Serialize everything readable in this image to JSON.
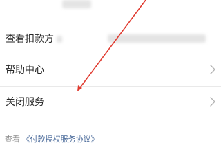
{
  "settings_list": {
    "rows": [
      {
        "label": "查看扣款方",
        "has_chevron": false,
        "masked": true
      },
      {
        "label": "帮助中心",
        "has_chevron": true,
        "masked": false
      },
      {
        "label": "关闭服务",
        "has_chevron": true,
        "masked": false
      }
    ]
  },
  "footer": {
    "prefix": "查看",
    "link_text": "《付款授权服务协议》"
  },
  "icons": {
    "chevron": "chevron-right-icon"
  },
  "colors": {
    "text_primary": "#262626",
    "text_secondary": "#8a8a8a",
    "link": "#4a6a9a",
    "divider": "#e9e9e9",
    "annotation_arrow": "#e03a2f"
  }
}
